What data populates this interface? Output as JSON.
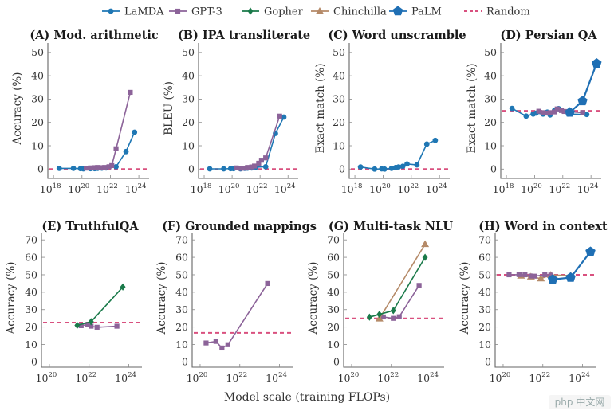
{
  "chart_data": {
    "type": "line",
    "xlabel": "Model scale (training FLOPs)",
    "xscale": "log",
    "legend": {
      "placement": "top-center",
      "entries": [
        {
          "name": "LaMDA",
          "color": "#1f77b4",
          "marker": "circle"
        },
        {
          "name": "GPT-3",
          "color": "#8c6399",
          "marker": "square"
        },
        {
          "name": "Gopher",
          "color": "#1a7a4a",
          "marker": "diamond"
        },
        {
          "name": "Chinchilla",
          "color": "#b58a68",
          "marker": "triangle"
        },
        {
          "name": "PaLM",
          "color": "#1f6fb4",
          "marker": "pentagon"
        },
        {
          "name": "Random",
          "color": "#d9507f",
          "marker": "dashed-line"
        }
      ]
    },
    "panels": [
      {
        "id": "A",
        "title": "(A) Mod. arithmetic",
        "ylabel": "Accuracy (%)",
        "xlim_exp": [
          17.6,
          24.5
        ],
        "xticks_exp": [
          18,
          20,
          22,
          24
        ],
        "ylim": [
          -4,
          52
        ],
        "yticks": [
          0,
          10,
          20,
          30,
          40,
          50
        ],
        "random": 0,
        "series": [
          {
            "name": "LaMDA",
            "x_exp": [
              18.4,
              19.4,
              19.9,
              20.1,
              20.6,
              20.9,
              21.1,
              21.4,
              21.7,
              22.4,
              23.1,
              23.7
            ],
            "y": [
              0.3,
              0.3,
              0.2,
              0.1,
              0.2,
              0.2,
              0.3,
              0.4,
              0.5,
              1.0,
              7.5,
              15.8
            ]
          },
          {
            "name": "GPT-3",
            "x_exp": [
              20.3,
              20.6,
              20.9,
              21.1,
              21.4,
              21.6,
              21.9,
              22.1,
              22.4,
              23.4
            ],
            "y": [
              0.4,
              0.5,
              0.6,
              0.7,
              0.6,
              0.7,
              1.0,
              1.5,
              8.7,
              32.9
            ]
          }
        ]
      },
      {
        "id": "B",
        "title": "(B) IPA transliterate",
        "ylabel": "BLEU (%)",
        "xlim_exp": [
          17.6,
          24.5
        ],
        "xticks_exp": [
          18,
          20,
          22,
          24
        ],
        "ylim": [
          -4,
          52
        ],
        "yticks": [
          0,
          10,
          20,
          30,
          40,
          50
        ],
        "random": 0,
        "series": [
          {
            "name": "LaMDA",
            "x_exp": [
              18.4,
              19.4,
              19.9,
              20.1,
              20.6,
              20.9,
              21.1,
              21.4,
              21.7,
              22.4,
              23.1,
              23.7
            ],
            "y": [
              0.1,
              0.1,
              0.2,
              0.2,
              0.1,
              0.3,
              0.4,
              0.5,
              0.8,
              1.0,
              15.3,
              22.3
            ]
          },
          {
            "name": "GPT-3",
            "x_exp": [
              20.3,
              20.6,
              20.9,
              21.1,
              21.4,
              21.6,
              21.9,
              22.1,
              22.4,
              23.4
            ],
            "y": [
              0.5,
              0.3,
              0.4,
              0.7,
              0.9,
              1.3,
              2.5,
              3.8,
              4.8,
              22.7
            ]
          }
        ]
      },
      {
        "id": "C",
        "title": "(C) Word unscramble",
        "ylabel": "Exact match (%)",
        "xlim_exp": [
          17.6,
          24.5
        ],
        "xticks_exp": [
          18,
          20,
          22,
          24
        ],
        "ylim": [
          -4,
          52
        ],
        "yticks": [
          0,
          10,
          20,
          30,
          40,
          50
        ],
        "random": 0,
        "series": [
          {
            "name": "LaMDA",
            "x_exp": [
              18.4,
              19.4,
              19.9,
              20.1,
              20.6,
              20.9,
              21.1,
              21.4,
              21.7,
              22.4,
              23.1,
              23.7
            ],
            "y": [
              0.9,
              0.0,
              0.1,
              0.0,
              0.3,
              0.7,
              0.9,
              1.2,
              2.2,
              1.8,
              10.7,
              12.3
            ]
          }
        ]
      },
      {
        "id": "D",
        "title": "(D) Persian QA",
        "ylabel": "Exact match (%)",
        "xlim_exp": [
          17.6,
          24.5
        ],
        "xticks_exp": [
          18,
          20,
          22,
          24
        ],
        "ylim": [
          -4,
          52
        ],
        "yticks": [
          0,
          10,
          20,
          30,
          40,
          50
        ],
        "random": 25,
        "series": [
          {
            "name": "LaMDA",
            "x_exp": [
              18.4,
              19.4,
              19.9,
              20.1,
              20.6,
              20.9,
              21.1,
              21.4,
              21.7,
              22.4,
              23.7
            ],
            "y": [
              26.0,
              22.7,
              23.6,
              24.0,
              23.6,
              24.4,
              23.2,
              25.0,
              25.9,
              23.6,
              23.4
            ]
          },
          {
            "name": "GPT-3",
            "x_exp": [
              20.3,
              20.6,
              20.9,
              21.1,
              21.4,
              21.6,
              21.9,
              22.1,
              22.4,
              23.4
            ],
            "y": [
              24.8,
              24.2,
              24.0,
              24.2,
              24.5,
              25.8,
              25.1,
              24.7,
              24.6,
              24.2
            ]
          },
          {
            "name": "PaLM",
            "x_exp": [
              22.5,
              23.4,
              24.4
            ],
            "y": [
              24.3,
              29.2,
              45.3
            ]
          }
        ]
      },
      {
        "id": "E",
        "title": "(E) TruthfulQA",
        "ylabel": "Accuracy (%)",
        "xlim_exp": [
          19.6,
          24.5
        ],
        "xticks_exp": [
          20,
          22,
          24
        ],
        "ylim": [
          -3,
          71
        ],
        "yticks": [
          0,
          10,
          20,
          30,
          40,
          50,
          60,
          70
        ],
        "random": 22.6,
        "series": [
          {
            "name": "GPT-3",
            "x_exp": [
              21.6,
              21.9,
              22.1,
              22.4,
              23.4
            ],
            "y": [
              20.8,
              21.5,
              20.5,
              19.9,
              20.5
            ]
          },
          {
            "name": "Gopher",
            "x_exp": [
              21.4,
              22.1,
              23.7
            ],
            "y": [
              21.0,
              23.1,
              43.0
            ]
          }
        ]
      },
      {
        "id": "F",
        "title": "(F) Grounded mappings",
        "ylabel": "Accuracy (%)",
        "xlim_exp": [
          19.6,
          24.5
        ],
        "xticks_exp": [
          20,
          22,
          24
        ],
        "ylim": [
          -3,
          71
        ],
        "yticks": [
          0,
          10,
          20,
          30,
          40,
          50,
          60,
          70
        ],
        "random": 16.7,
        "series": [
          {
            "name": "GPT-3",
            "x_exp": [
              20.3,
              20.8,
              21.1,
              21.4,
              23.4
            ],
            "y": [
              10.9,
              11.8,
              8.0,
              9.9,
              45.0
            ]
          }
        ]
      },
      {
        "id": "G",
        "title": "(G) Multi-task NLU",
        "ylabel": "Accuracy (%)",
        "xlim_exp": [
          19.6,
          24.5
        ],
        "xticks_exp": [
          20,
          22,
          24
        ],
        "ylim": [
          -3,
          71
        ],
        "yticks": [
          0,
          10,
          20,
          30,
          40,
          50,
          60,
          70
        ],
        "random": 25,
        "series": [
          {
            "name": "GPT-3",
            "x_exp": [
              21.6,
              22.1,
              22.4,
              23.4
            ],
            "y": [
              25.8,
              25.0,
              25.9,
              43.9
            ]
          },
          {
            "name": "Chinchilla",
            "x_exp": [
              21.4,
              23.7
            ],
            "y": [
              24.8,
              67.5
            ]
          },
          {
            "name": "Gopher",
            "x_exp": [
              20.9,
              21.4,
              22.1,
              23.7
            ],
            "y": [
              25.7,
              27.3,
              29.5,
              60.0
            ]
          }
        ]
      },
      {
        "id": "H",
        "title": "(H) Word in context",
        "ylabel": "Accuracy (%)",
        "xlim_exp": [
          19.6,
          24.5
        ],
        "xticks_exp": [
          20,
          22,
          24
        ],
        "ylim": [
          -3,
          71
        ],
        "yticks": [
          0,
          10,
          20,
          30,
          40,
          50,
          60,
          70
        ],
        "random": 50,
        "series": [
          {
            "name": "Chinchilla",
            "x_exp": [
              20.9,
              21.4,
              21.9,
              22.4,
              23.4
            ],
            "y": [
              49.4,
              48.9,
              47.8,
              49.9,
              49.5
            ]
          },
          {
            "name": "GPT-3",
            "x_exp": [
              20.3,
              20.8,
              21.1,
              21.4,
              21.6,
              22.1,
              22.4
            ],
            "y": [
              50.0,
              50.1,
              50.0,
              49.3,
              49.2,
              50.0,
              49.8
            ]
          },
          {
            "name": "PaLM",
            "x_exp": [
              22.5,
              23.4,
              24.4
            ],
            "y": [
              47.3,
              48.4,
              63.2
            ]
          }
        ]
      }
    ]
  },
  "watermark": {
    "text": "php 中文网"
  }
}
